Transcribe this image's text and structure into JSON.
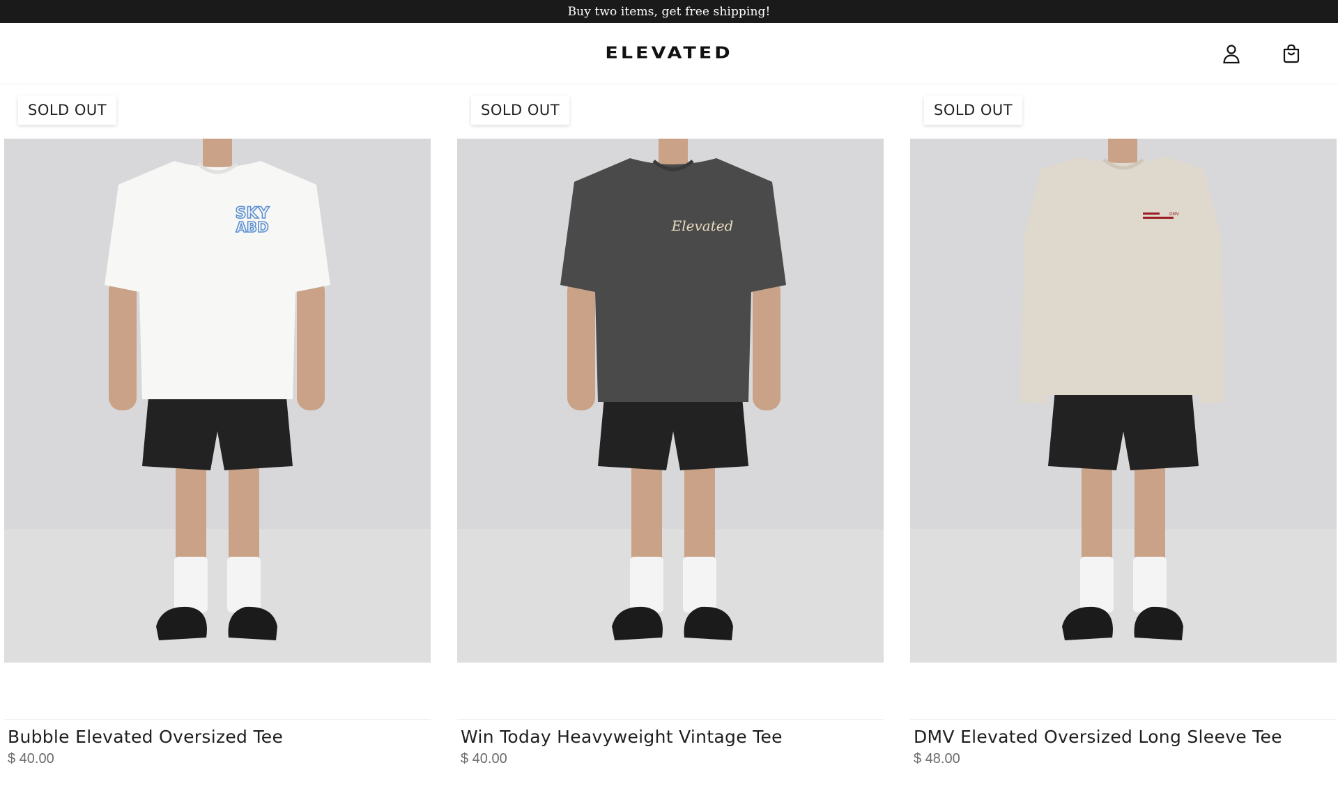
{
  "announcement": {
    "text": "Buy two items, get free shipping!"
  },
  "header": {
    "logo": "ELEVATED",
    "icons": [
      "account-icon",
      "cart-icon"
    ]
  },
  "products": [
    {
      "badge": "SOLD OUT",
      "title": "Bubble Elevated Oversized Tee",
      "price": "$ 40.00",
      "shirt_color": "#f7f7f5",
      "print_color": "#5b8fd1"
    },
    {
      "badge": "SOLD OUT",
      "title": "Win Today Heavyweight Vintage Tee",
      "price": "$ 40.00",
      "shirt_color": "#4a4a4a",
      "print_color": "#e9dcc0"
    },
    {
      "badge": "SOLD OUT",
      "title": "DMV Elevated Oversized Long Sleeve Tee",
      "price": "$ 48.00",
      "shirt_color": "#dfd8cc",
      "print_color": "#9b1c24"
    }
  ],
  "colors": {
    "announcement_bg": "#1a1a1a",
    "photo_bg": "#d8d8da",
    "shorts": "#222222",
    "skin": "#c9a287"
  }
}
